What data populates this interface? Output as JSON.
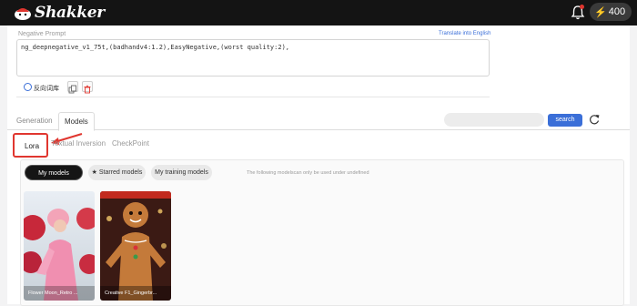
{
  "header": {
    "logo_text": "Shakker",
    "credits": "400",
    "icons": [
      "logo-mascot-icon",
      "bell-icon",
      "bolt-icon"
    ]
  },
  "negative_prompt": {
    "label": "Negative Prompt",
    "translate_link": "Translate into English",
    "value": "ng_deepnegative_v1_75t,(badhandv4:1.2),EasyNegative,(worst quality:2),",
    "reverse_label": "反向词库"
  },
  "tabs": [
    "Generation",
    "Models"
  ],
  "active_tab": "Models",
  "subtabs": {
    "lora": "Lora",
    "textual_inversion": "Textual Inversion",
    "checkpoint": "CheckPoint"
  },
  "search": {
    "placeholder": "",
    "button": "search"
  },
  "filters": {
    "my_models": "My models",
    "starred": "Starred models",
    "training": "My training models",
    "note": "The following modelscan only be used under undefined"
  },
  "cards": [
    {
      "label": "Flower Moon_Retro ..."
    },
    {
      "label": "Creative F1_Gingerbr..."
    }
  ],
  "colors": {
    "accent": "#3b6fd8",
    "highlight": "#e0362f",
    "topbar": "#141414"
  }
}
